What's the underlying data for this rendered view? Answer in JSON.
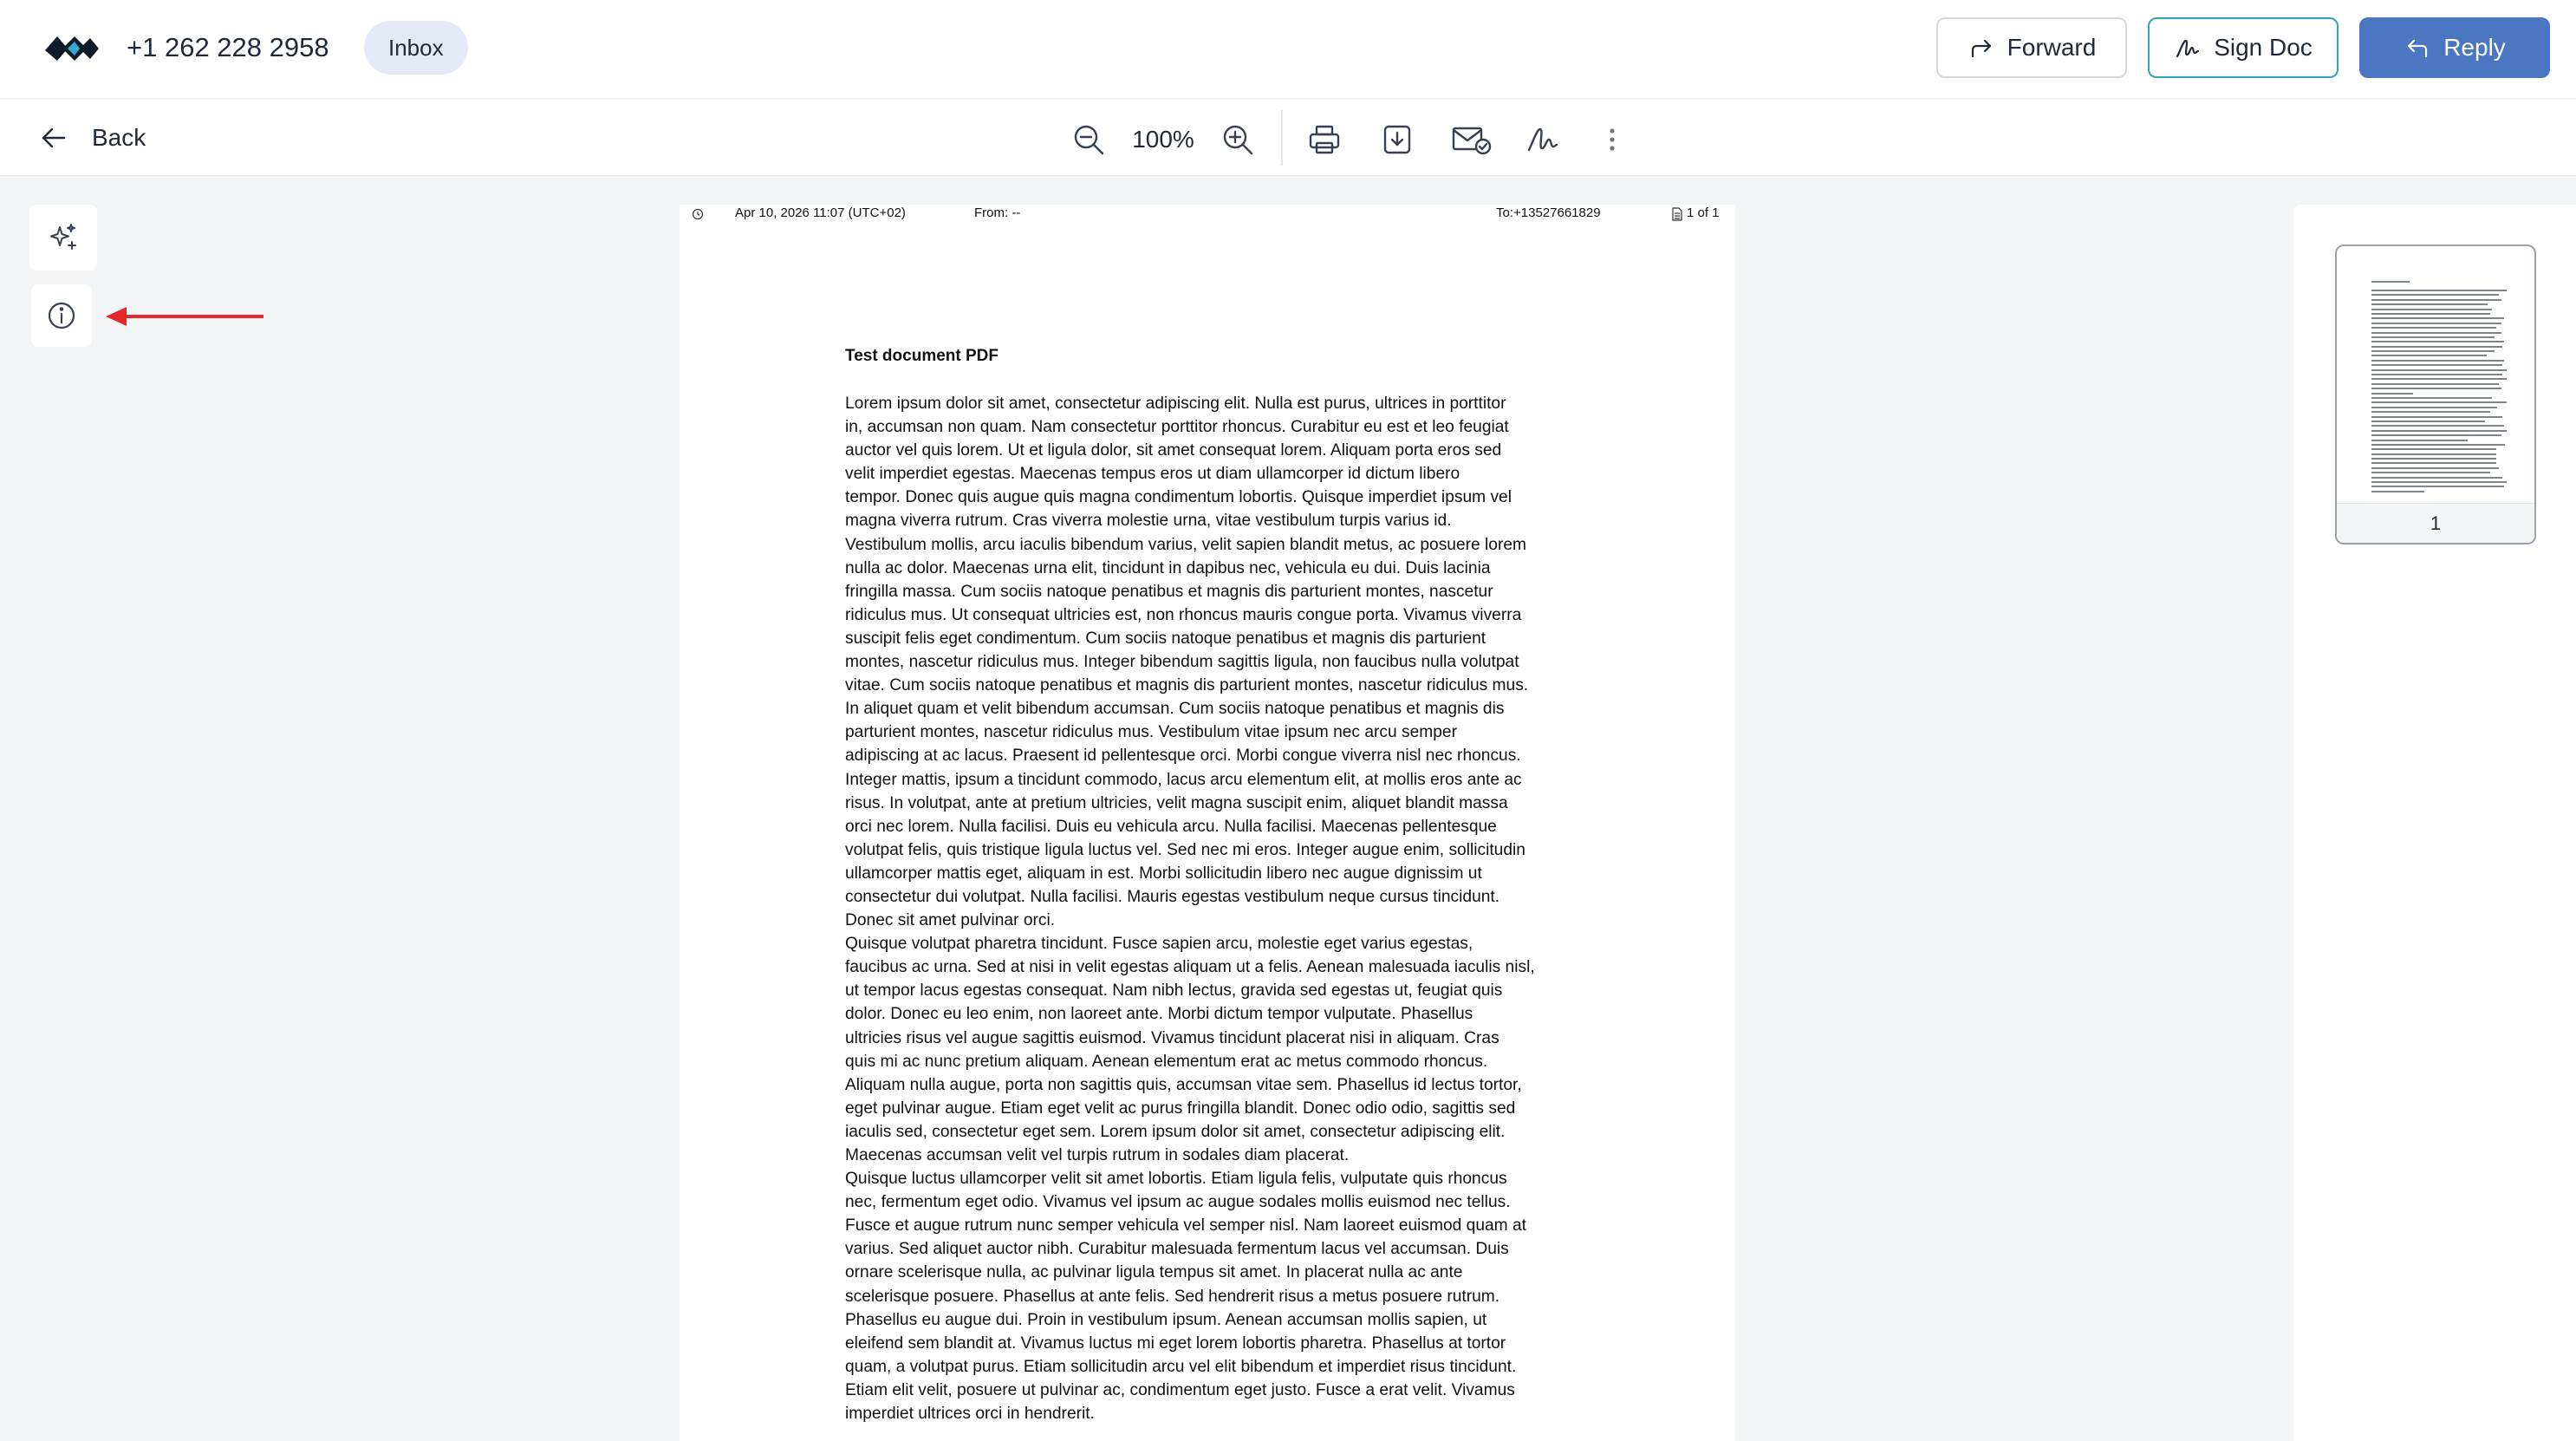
{
  "header": {
    "phone": "+1 262 228 2958",
    "folder_badge": "Inbox",
    "forward_label": "Forward",
    "sign_label": "Sign Doc",
    "reply_label": "Reply",
    "colors": {
      "reply_bg": "#4a76c2",
      "sign_border": "#2fa6b6",
      "badge_bg": "#e3e9f7"
    }
  },
  "toolbar": {
    "back_label": "Back",
    "zoom_level": "100%",
    "icons": [
      "zoom-out-icon",
      "zoom-in-icon",
      "print-icon",
      "download-icon",
      "email-check-icon",
      "signature-icon",
      "more-vertical-icon"
    ]
  },
  "left_rail": {
    "icons": [
      "sparkles-icon",
      "info-icon"
    ],
    "annotation_arrow_color": "#e5262b"
  },
  "document": {
    "meta": {
      "date": "Apr 10, 2026 11:07 (UTC+02)",
      "from": "From:   --",
      "to": "To:+13527661829",
      "pages": "1 of 1"
    },
    "title": "Test document PDF",
    "body": "Lorem ipsum dolor sit amet, consectetur adipiscing elit. Nulla est purus, ultrices in porttitor\nin, accumsan non quam. Nam consectetur porttitor rhoncus. Curabitur eu est et leo feugiat\nauctor vel quis lorem. Ut et ligula dolor, sit amet consequat lorem. Aliquam porta eros sed\nvelit imperdiet egestas. Maecenas tempus eros ut diam ullamcorper id dictum libero\ntempor. Donec quis augue quis magna condimentum lobortis. Quisque imperdiet ipsum vel\nmagna viverra rutrum. Cras viverra molestie urna, vitae vestibulum turpis varius id.\nVestibulum mollis, arcu iaculis bibendum varius, velit sapien blandit metus, ac posuere lorem\nnulla ac dolor. Maecenas urna elit, tincidunt in dapibus nec, vehicula eu dui. Duis lacinia\nfringilla massa. Cum sociis natoque penatibus et magnis dis parturient montes, nascetur\nridiculus mus. Ut consequat ultricies est, non rhoncus mauris congue porta. Vivamus viverra\nsuscipit felis eget condimentum. Cum sociis natoque penatibus et magnis dis parturient\nmontes, nascetur ridiculus mus. Integer bibendum sagittis ligula, non faucibus nulla volutpat\nvitae. Cum sociis natoque penatibus et magnis dis parturient montes, nascetur ridiculus mus.\nIn aliquet quam et velit bibendum accumsan. Cum sociis natoque penatibus et magnis dis\nparturient montes, nascetur ridiculus mus. Vestibulum vitae ipsum nec arcu semper\nadipiscing at ac lacus. Praesent id pellentesque orci. Morbi congue viverra nisl nec rhoncus.\nInteger mattis, ipsum a tincidunt commodo, lacus arcu elementum elit, at mollis eros ante ac\nrisus. In volutpat, ante at pretium ultricies, velit magna suscipit enim, aliquet blandit massa\norci nec lorem. Nulla facilisi. Duis eu vehicula arcu. Nulla facilisi. Maecenas pellentesque\nvolutpat felis, quis tristique ligula luctus vel. Sed nec mi eros. Integer augue enim, sollicitudin\nullamcorper mattis eget, aliquam in est. Morbi sollicitudin libero nec augue dignissim ut\nconsectetur dui volutpat. Nulla facilisi. Mauris egestas vestibulum neque cursus tincidunt.\nDonec sit amet pulvinar orci.\nQuisque volutpat pharetra tincidunt. Fusce sapien arcu, molestie eget varius egestas,\nfaucibus ac urna. Sed at nisi in velit egestas aliquam ut a felis. Aenean malesuada iaculis nisl,\nut tempor lacus egestas consequat. Nam nibh lectus, gravida sed egestas ut, feugiat quis\ndolor. Donec eu leo enim, non laoreet ante. Morbi dictum tempor vulputate. Phasellus\nultricies risus vel augue sagittis euismod. Vivamus tincidunt placerat nisi in aliquam. Cras\nquis mi ac nunc pretium aliquam. Aenean elementum erat ac metus commodo rhoncus.\nAliquam nulla augue, porta non sagittis quis, accumsan vitae sem. Phasellus id lectus tortor,\neget pulvinar augue. Etiam eget velit ac purus fringilla blandit. Donec odio odio, sagittis sed\niaculis sed, consectetur eget sem. Lorem ipsum dolor sit amet, consectetur adipiscing elit.\nMaecenas accumsan velit vel turpis rutrum in sodales diam placerat.\nQuisque luctus ullamcorper velit sit amet lobortis. Etiam ligula felis, vulputate quis rhoncus\nnec, fermentum eget odio. Vivamus vel ipsum ac augue sodales mollis euismod nec tellus.\nFusce et augue rutrum nunc semper vehicula vel semper nisl. Nam laoreet euismod quam at\nvarius. Sed aliquet auctor nibh. Curabitur malesuada fermentum lacus vel accumsan. Duis\nornare scelerisque nulla, ac pulvinar ligula tempus sit amet. In placerat nulla ac ante\nscelerisque posuere. Phasellus at ante felis. Sed hendrerit risus a metus posuere rutrum.\nPhasellus eu augue dui. Proin in vestibulum ipsum. Aenean accumsan mollis sapien, ut\neleifend sem blandit at. Vivamus luctus mi eget lorem lobortis pharetra. Phasellus at tortor\nquam, a volutpat purus. Etiam sollicitudin arcu vel elit bibendum et imperdiet risus tincidunt.\nEtiam elit velit, posuere ut pulvinar ac, condimentum eget justo. Fusce a erat velit. Vivamus\nimperdiet ultrices orci in hendrerit."
  },
  "thumbnails": {
    "pages": [
      {
        "label": "1"
      }
    ]
  }
}
